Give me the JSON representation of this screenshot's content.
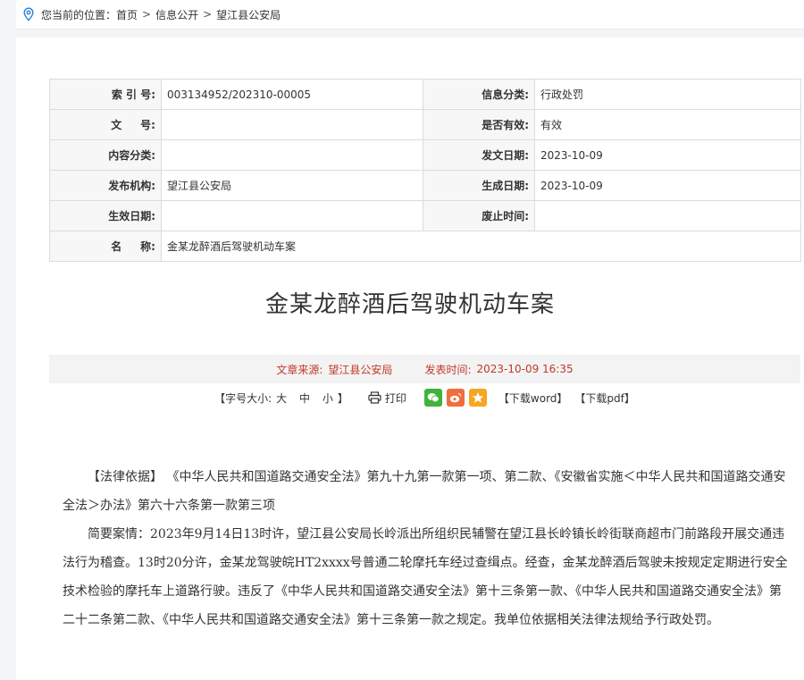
{
  "breadcrumb": {
    "prefix": "您当前的位置：",
    "items": [
      "首页",
      "信息公开",
      "望江县公安局"
    ],
    "separator": ">"
  },
  "meta": {
    "index_label": "索 引 号:",
    "index_value": "003134952/202310-00005",
    "category_label": "信息分类:",
    "category_value": "行政处罚",
    "docno_label": "文     号:",
    "docno_value": "",
    "valid_label": "是否有效:",
    "valid_value": "有效",
    "content_cat_label": "内容分类:",
    "content_cat_value": "",
    "pub_date_label": "发文日期:",
    "pub_date_value": "2023-10-09",
    "org_label": "发布机构:",
    "org_value": "望江县公安局",
    "gen_date_label": "生成日期:",
    "gen_date_value": "2023-10-09",
    "effective_label": "生效日期:",
    "effective_value": "",
    "abolish_label": "废止时间:",
    "abolish_value": "",
    "name_label": "名     称:",
    "name_value": "金某龙醉酒后驾驶机动车案"
  },
  "article": {
    "title": "金某龙醉酒后驾驶机动车案",
    "source_label": "文章来源:",
    "source_value": "望江县公安局",
    "time_label": "发表时间:",
    "time_value": "2023-10-09 16:35"
  },
  "tools": {
    "font_size_label": "【字号大小:",
    "size_large": "大",
    "size_medium": "中",
    "size_small": "小",
    "font_size_close": "】",
    "print": "打印",
    "download_word": "【下载word】",
    "download_pdf": "【下载pdf】"
  },
  "body": {
    "p1": "【法律依据】 《中华人民共和国道路交通安全法》第九十九第一款第一项、第二款、《安徽省实施＜中华人民共和国道路交通安全法＞办法》第六十六条第一款第三项",
    "p2": "简要案情：2023年9月14日13时许，望江县公安局长岭派出所组织民辅警在望江县长岭镇长岭街联商超市门前路段开展交通违法行为稽查。13时20分许，金某龙驾驶皖HT2xxxx号普通二轮摩托车经过查缉点。经查，金某龙醉酒后驾驶未按规定定期进行安全技术检验的摩托车上道路行驶。违反了《中华人民共和国道路交通安全法》第十三条第一款、《中华人民共和国道路交通安全法》第二十二条第二款、《中华人民共和国道路交通安全法》第十三条第一款之规定。我单位依据相关法律法规给予行政处罚。"
  },
  "icons": {
    "location": "location-pin-icon",
    "print": "printer-icon",
    "wechat": "wechat-icon",
    "weibo": "weibo-icon",
    "favorite": "star-icon"
  },
  "colors": {
    "accent_red": "#c0392b",
    "wechat_green": "#3fb33b",
    "weibo_orange": "#f26d3d",
    "fav_yellow": "#f6a623",
    "pin_blue": "#2a7fd4"
  }
}
